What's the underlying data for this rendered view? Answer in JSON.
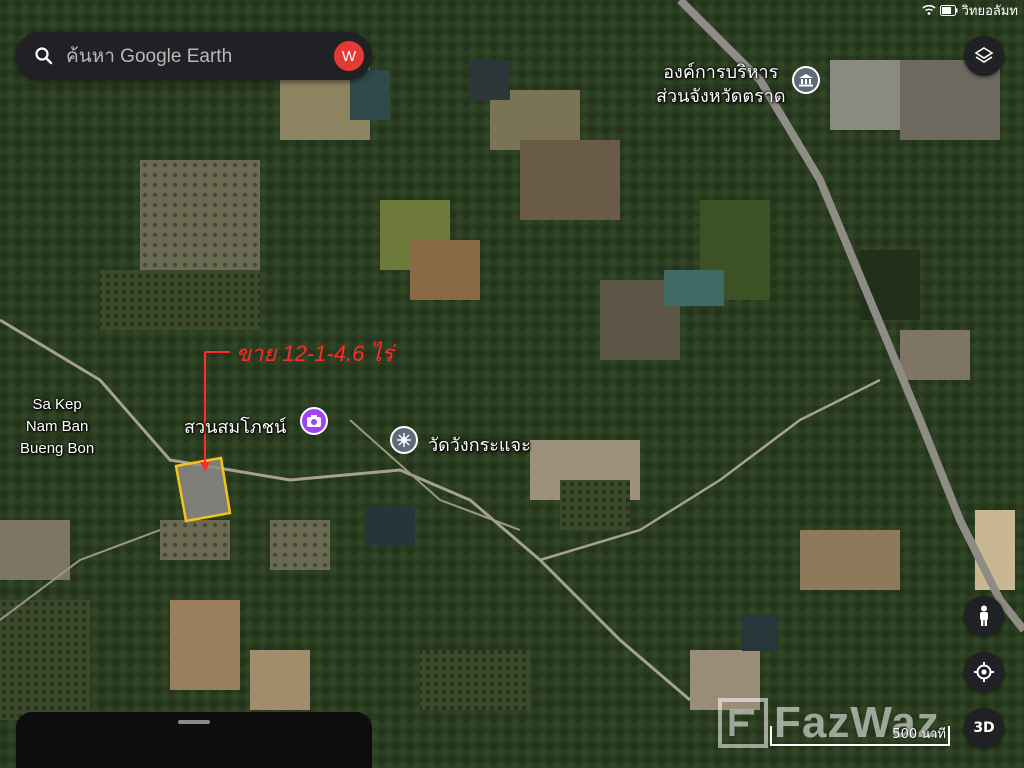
{
  "search": {
    "placeholder": "ค้นหา Google Earth",
    "avatar_letter": "W"
  },
  "status_bar": {
    "carrier_text": "วิทยอลัมท"
  },
  "labels": {
    "org": "องค์การบริหารส่วนจังหวัดตราด",
    "org_line1": "องค์การบริหาร",
    "org_line2": "ส่วนจังหวัดตราด",
    "place_line1": "Sa Kep",
    "place_line2": "Nam Ban",
    "place_line3": "Bueng Bon",
    "garden": "สวนสมโภชน์",
    "temple": "วัดวังกระแจะ",
    "annotation": "ขาย 12-1-4.6 ไร่"
  },
  "buttons": {
    "three_d": "3D"
  },
  "scale": {
    "text": "500 นาที"
  },
  "watermark": {
    "text": "FazWaz"
  },
  "colors": {
    "plot_outline": "#f2c21a",
    "annotation": "#ff2a2a",
    "garden_poi": "#a142f4",
    "temple_poi": "#5f6b7a",
    "org_poi": "#5f6b7a",
    "avatar": "#e53935"
  },
  "icons": [
    "search-icon",
    "layers-icon",
    "pegman-icon",
    "my-location-icon",
    "org-poi-icon",
    "garden-camera-icon",
    "temple-poi-icon",
    "wifi-icon",
    "battery-icon"
  ]
}
